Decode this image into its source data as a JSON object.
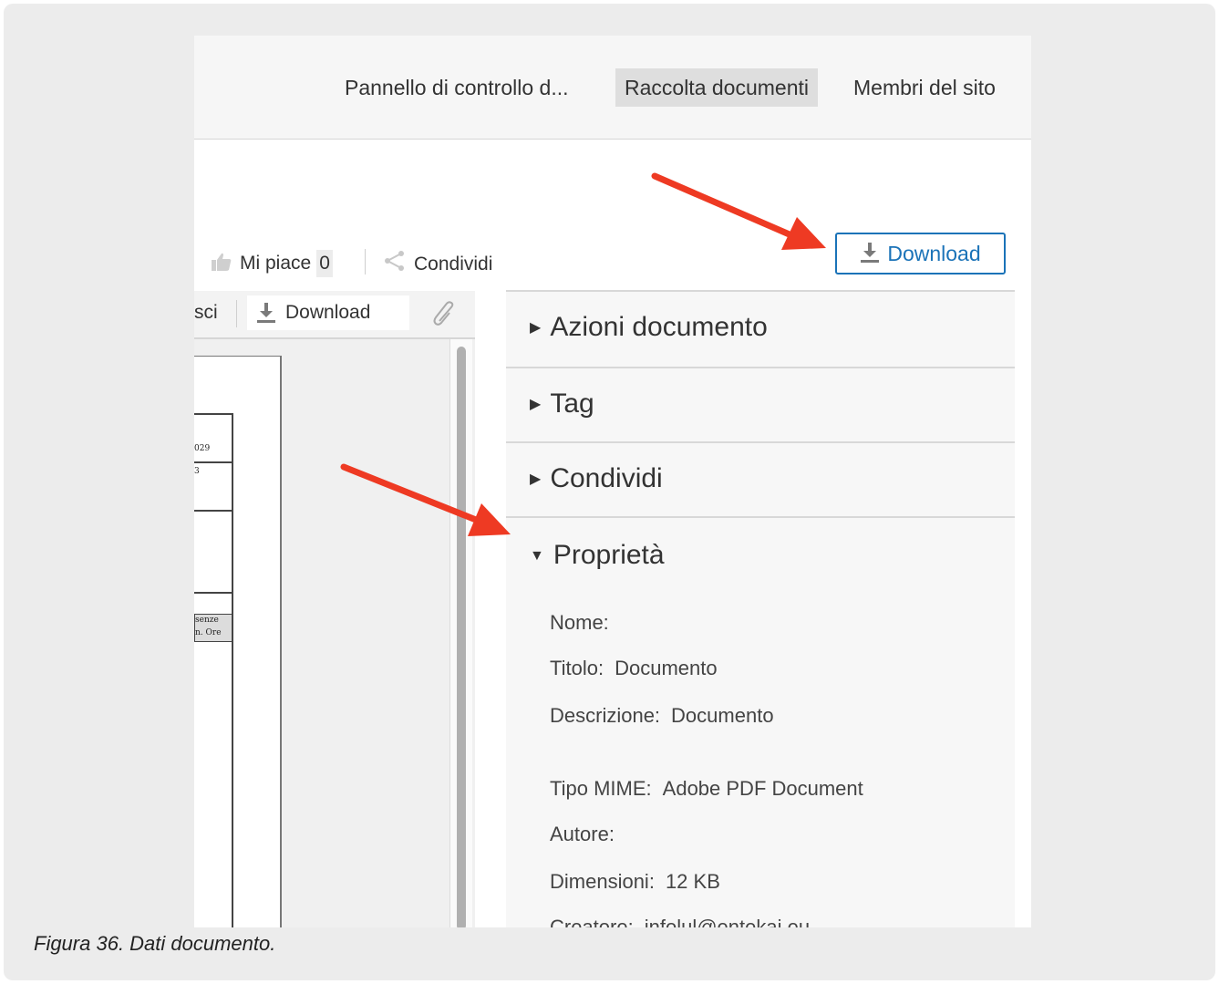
{
  "nav": {
    "items": [
      {
        "label": "Pannello di controllo d..."
      },
      {
        "label": "Raccolta documenti"
      },
      {
        "label": "Membri del sito"
      }
    ]
  },
  "social": {
    "like_label": "Mi piace",
    "like_count": "0",
    "share_label": "Condividi"
  },
  "download_button": "Download",
  "viewer_toolbar": {
    "partial_label": "sci",
    "download_label": "Download"
  },
  "document_page": {
    "cell_1": "029",
    "cell_2": "3",
    "cell_3a": "senze",
    "cell_3b": "n. Ore"
  },
  "panel": {
    "sections": [
      {
        "label": "Azioni documento",
        "expanded": false
      },
      {
        "label": "Tag",
        "expanded": false
      },
      {
        "label": "Condividi",
        "expanded": false
      },
      {
        "label": "Proprietà",
        "expanded": true
      }
    ],
    "properties": [
      {
        "key": "Nome:",
        "value": ""
      },
      {
        "key": "Titolo:",
        "value": "Documento"
      },
      {
        "key": "Descrizione:",
        "value": "Documento"
      },
      {
        "key": "Tipo MIME:",
        "value": "Adobe PDF Document"
      },
      {
        "key": "Autore:",
        "value": ""
      },
      {
        "key": "Dimensioni:",
        "value": "12 KB"
      },
      {
        "key": "Creatore:",
        "value": "infolul@entekai.eu"
      }
    ]
  },
  "caption": "Figura 36. Dati documento.",
  "colors": {
    "accent": "#1b73b8",
    "arrow": "#ee3a23",
    "frame": "#ececec"
  },
  "icons": [
    "thumbs-up-icon",
    "share-icon",
    "download-icon",
    "paperclip-icon",
    "triangle-right-icon",
    "triangle-down-icon",
    "arrow-icon"
  ]
}
